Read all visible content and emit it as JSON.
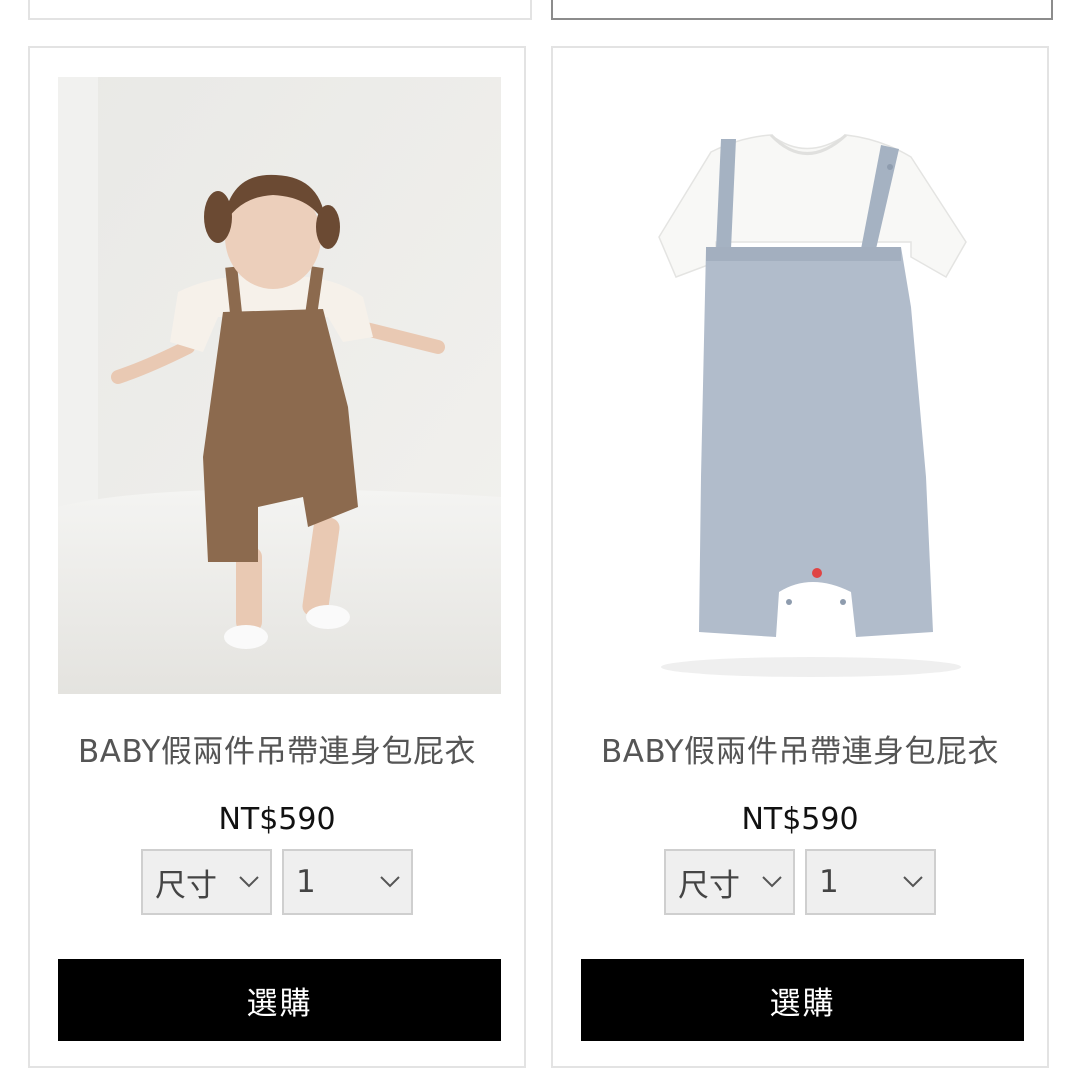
{
  "products": [
    {
      "title": "BABY假兩件吊帶連身包屁衣",
      "price": "NT$590",
      "size_select_value": "尺寸",
      "qty_select_value": "1",
      "buy_label": "選購",
      "image_icon": "baby-in-brown-overalls-photo"
    },
    {
      "title": "BABY假兩件吊帶連身包屁衣",
      "price": "NT$590",
      "size_select_value": "尺寸",
      "qty_select_value": "1",
      "buy_label": "選購",
      "image_icon": "grey-romper-product-photo"
    }
  ]
}
